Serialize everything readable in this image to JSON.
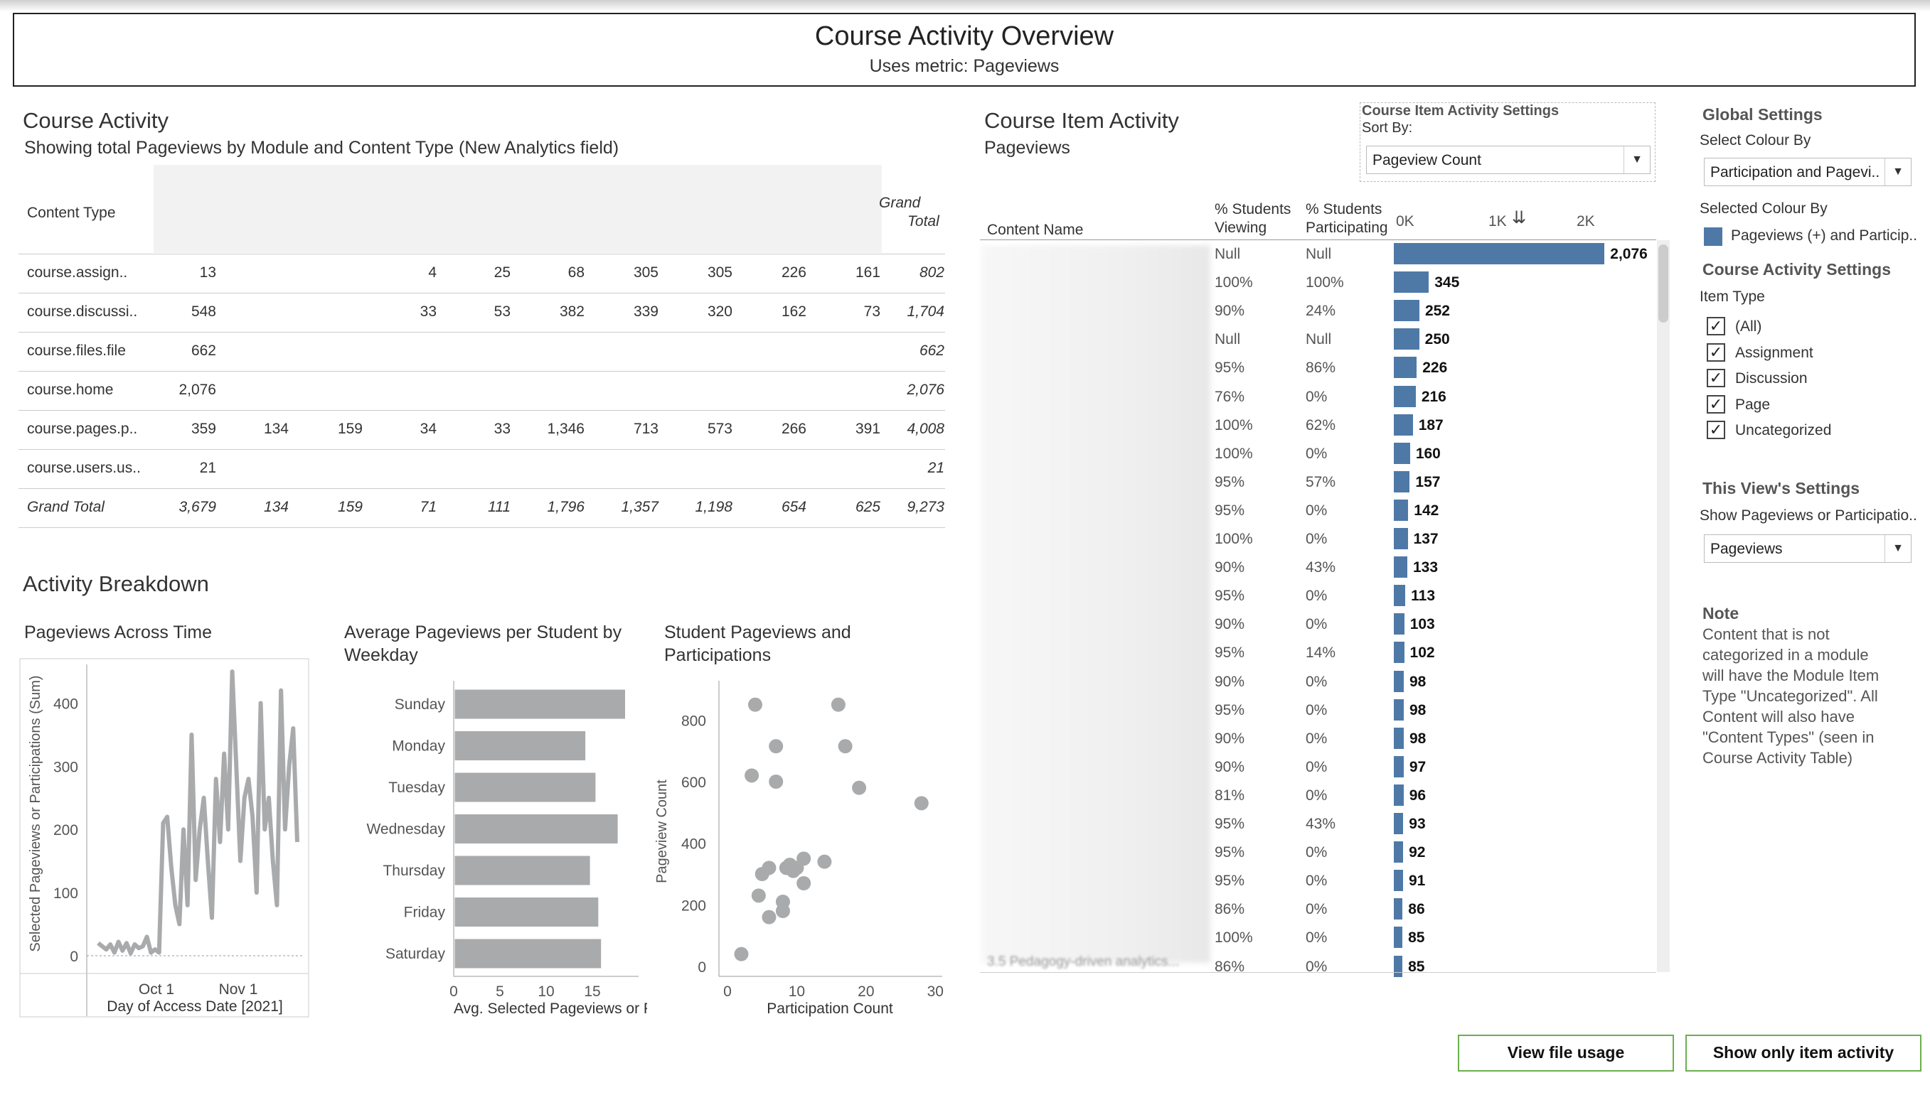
{
  "header": {
    "title": "Course Activity Overview",
    "subtitle": "Uses metric: Pageviews"
  },
  "course_activity": {
    "title": "Course Activity",
    "subtitle": "Showing total Pageviews by Module and Content Type (New Analytics field)",
    "col_content_type": "Content Type",
    "col_grand_total": "Grand",
    "col_grand_total2": "Total",
    "rows": [
      {
        "label": "course.assign..",
        "cells": [
          "13",
          "",
          "",
          "4",
          "25",
          "68",
          "305",
          "305",
          "226",
          "161"
        ],
        "total": "802"
      },
      {
        "label": "course.discussi..",
        "cells": [
          "548",
          "",
          "",
          "33",
          "53",
          "382",
          "339",
          "320",
          "162",
          "73"
        ],
        "total": "1,704"
      },
      {
        "label": "course.files.file",
        "cells": [
          "662",
          "",
          "",
          "",
          "",
          "",
          "",
          "",
          "",
          ""
        ],
        "total": "662"
      },
      {
        "label": "course.home",
        "cells": [
          "2,076",
          "",
          "",
          "",
          "",
          "",
          "",
          "",
          "",
          ""
        ],
        "total": "2,076"
      },
      {
        "label": "course.pages.p..",
        "cells": [
          "359",
          "134",
          "159",
          "34",
          "33",
          "1,346",
          "713",
          "573",
          "266",
          "391"
        ],
        "total": "4,008"
      },
      {
        "label": "course.users.us..",
        "cells": [
          "21",
          "",
          "",
          "",
          "",
          "",
          "",
          "",
          "",
          ""
        ],
        "total": "21"
      }
    ],
    "grand_total_row": {
      "label": "Grand Total",
      "cells": [
        "3,679",
        "134",
        "159",
        "71",
        "111",
        "1,796",
        "1,357",
        "1,198",
        "654",
        "625"
      ],
      "total": "9,273"
    }
  },
  "activity_breakdown": {
    "title": "Activity Breakdown",
    "time_chart_title": "Pageviews Across Time",
    "weekday_title_1": "Average Pageviews per Student by",
    "weekday_title_2": "Weekday",
    "scatter_title_1": "Student Pageviews and",
    "scatter_title_2": "Participations"
  },
  "chart_data": [
    {
      "type": "line",
      "title": "Pageviews Across Time",
      "xlabel": "Day of Access Date [2021]",
      "ylabel": "Selected Pageviews or Participations (Sum)",
      "x_ticks": [
        "Oct 1",
        "Nov 1"
      ],
      "y_ticks": [
        "0",
        "100",
        "200",
        "300",
        "400"
      ],
      "ylim": [
        0,
        450
      ],
      "values": [
        20,
        15,
        10,
        18,
        5,
        22,
        8,
        20,
        4,
        18,
        12,
        15,
        30,
        5,
        10,
        5,
        210,
        220,
        140,
        80,
        50,
        200,
        80,
        350,
        120,
        200,
        250,
        150,
        60,
        280,
        180,
        320,
        200,
        450,
        300,
        150,
        250,
        280,
        220,
        100,
        400,
        200,
        250,
        150,
        80,
        420,
        200,
        300,
        360,
        180
      ]
    },
    {
      "type": "bar",
      "title": "Average Pageviews per Student by Weekday",
      "categories": [
        "Sunday",
        "Monday",
        "Tuesday",
        "Wednesday",
        "Thursday",
        "Friday",
        "Saturday"
      ],
      "values": [
        18.5,
        14.2,
        15.3,
        17.7,
        14.7,
        15.6,
        15.9
      ],
      "xlabel": "Avg. Selected Pageviews or P..",
      "x_ticks": [
        "0",
        "5",
        "10",
        "15"
      ],
      "xlim": [
        0,
        20
      ]
    },
    {
      "type": "scatter",
      "title": "Student Pageviews and Participations",
      "xlabel": "Participation Count",
      "ylabel": "Pageview Count",
      "x_ticks": [
        "0",
        "10",
        "20",
        "30"
      ],
      "y_ticks": [
        "0",
        "200",
        "400",
        "600",
        "800"
      ],
      "xlim": [
        0,
        31
      ],
      "ylim": [
        0,
        900
      ],
      "points": [
        [
          4,
          850
        ],
        [
          16,
          850
        ],
        [
          7,
          715
        ],
        [
          17,
          715
        ],
        [
          3.5,
          620
        ],
        [
          7,
          600
        ],
        [
          19,
          580
        ],
        [
          28,
          530
        ],
        [
          2,
          40
        ],
        [
          5,
          300
        ],
        [
          6,
          320
        ],
        [
          4.5,
          230
        ],
        [
          6,
          160
        ],
        [
          8,
          180
        ],
        [
          8,
          210
        ],
        [
          8.5,
          320
        ],
        [
          9,
          330
        ],
        [
          9.5,
          310
        ],
        [
          10,
          320
        ],
        [
          11,
          350
        ],
        [
          11,
          270
        ],
        [
          14,
          340
        ]
      ]
    },
    {
      "type": "bar",
      "title": "Course Item Activity",
      "orientation": "horizontal",
      "x_ticks": [
        "0K",
        "1K",
        "2K"
      ],
      "xlim": [
        0,
        2200
      ],
      "values": [
        2076,
        345,
        252,
        250,
        226,
        216,
        187,
        160,
        157,
        142,
        137,
        133,
        113,
        103,
        102,
        98,
        98,
        98,
        97,
        96,
        93,
        92,
        91,
        86,
        85,
        85
      ]
    }
  ],
  "course_item_activity": {
    "title": "Course Item Activity",
    "subtitle": "Pageviews",
    "settings_title": "Course Item Activity Settings",
    "sort_by_label": "Sort By:",
    "sort_by_value": "Pageview Count",
    "col_content_name": "Content Name",
    "col_viewing_1": "% Students",
    "col_viewing_2": "Viewing",
    "col_participating_1": "% Students",
    "col_participating_2": "Participating",
    "last_row_name": "3.5 Pedagogy-driven analytics...",
    "rows": [
      {
        "viewing": "Null",
        "participating": "Null",
        "value": "2,076",
        "n": 2076
      },
      {
        "viewing": "100%",
        "participating": "100%",
        "value": "345",
        "n": 345
      },
      {
        "viewing": "90%",
        "participating": "24%",
        "value": "252",
        "n": 252
      },
      {
        "viewing": "Null",
        "participating": "Null",
        "value": "250",
        "n": 250
      },
      {
        "viewing": "95%",
        "participating": "86%",
        "value": "226",
        "n": 226
      },
      {
        "viewing": "76%",
        "participating": "0%",
        "value": "216",
        "n": 216
      },
      {
        "viewing": "100%",
        "participating": "62%",
        "value": "187",
        "n": 187
      },
      {
        "viewing": "100%",
        "participating": "0%",
        "value": "160",
        "n": 160
      },
      {
        "viewing": "95%",
        "participating": "57%",
        "value": "157",
        "n": 157
      },
      {
        "viewing": "95%",
        "participating": "0%",
        "value": "142",
        "n": 142
      },
      {
        "viewing": "100%",
        "participating": "0%",
        "value": "137",
        "n": 137
      },
      {
        "viewing": "90%",
        "participating": "43%",
        "value": "133",
        "n": 133
      },
      {
        "viewing": "95%",
        "participating": "0%",
        "value": "113",
        "n": 113
      },
      {
        "viewing": "90%",
        "participating": "0%",
        "value": "103",
        "n": 103
      },
      {
        "viewing": "95%",
        "participating": "14%",
        "value": "102",
        "n": 102
      },
      {
        "viewing": "90%",
        "participating": "0%",
        "value": "98",
        "n": 98
      },
      {
        "viewing": "95%",
        "participating": "0%",
        "value": "98",
        "n": 98
      },
      {
        "viewing": "90%",
        "participating": "0%",
        "value": "98",
        "n": 98
      },
      {
        "viewing": "90%",
        "participating": "0%",
        "value": "97",
        "n": 97
      },
      {
        "viewing": "81%",
        "participating": "0%",
        "value": "96",
        "n": 96
      },
      {
        "viewing": "95%",
        "participating": "43%",
        "value": "93",
        "n": 93
      },
      {
        "viewing": "95%",
        "participating": "0%",
        "value": "92",
        "n": 92
      },
      {
        "viewing": "95%",
        "participating": "0%",
        "value": "91",
        "n": 91
      },
      {
        "viewing": "86%",
        "participating": "0%",
        "value": "86",
        "n": 86
      },
      {
        "viewing": "100%",
        "participating": "0%",
        "value": "85",
        "n": 85
      },
      {
        "viewing": "86%",
        "participating": "0%",
        "value": "85",
        "n": 85
      }
    ]
  },
  "global_settings": {
    "title": "Global Settings",
    "select_colour_label": "Select Colour By",
    "select_colour_value": "Participation and Pagevi...",
    "selected_colour_label": "Selected Colour By",
    "legend_label": "Pageviews (+) and Particip..",
    "legend_color": "#4e79a7"
  },
  "course_activity_settings": {
    "title": "Course Activity Settings",
    "item_type_label": "Item Type",
    "items": [
      "(All)",
      "Assignment",
      "Discussion",
      "Page",
      "Uncategorized"
    ]
  },
  "view_settings": {
    "title": "This View's Settings",
    "show_label": "Show Pageviews or Participatio..",
    "show_value": "Pageviews"
  },
  "note": {
    "title": "Note",
    "text": "Content that is not categorized in a module will have the Module Item Type \"Uncategorized\". All Content will also have \"Content Types\" (seen in Course Activity Table)"
  },
  "buttons": {
    "view_file_usage": "View file usage",
    "show_item_activity": "Show only item activity"
  },
  "colors": {
    "bar_blue": "#4e79a7",
    "chart_gray": "#a9aaab",
    "button_border": "#6ab04c"
  }
}
